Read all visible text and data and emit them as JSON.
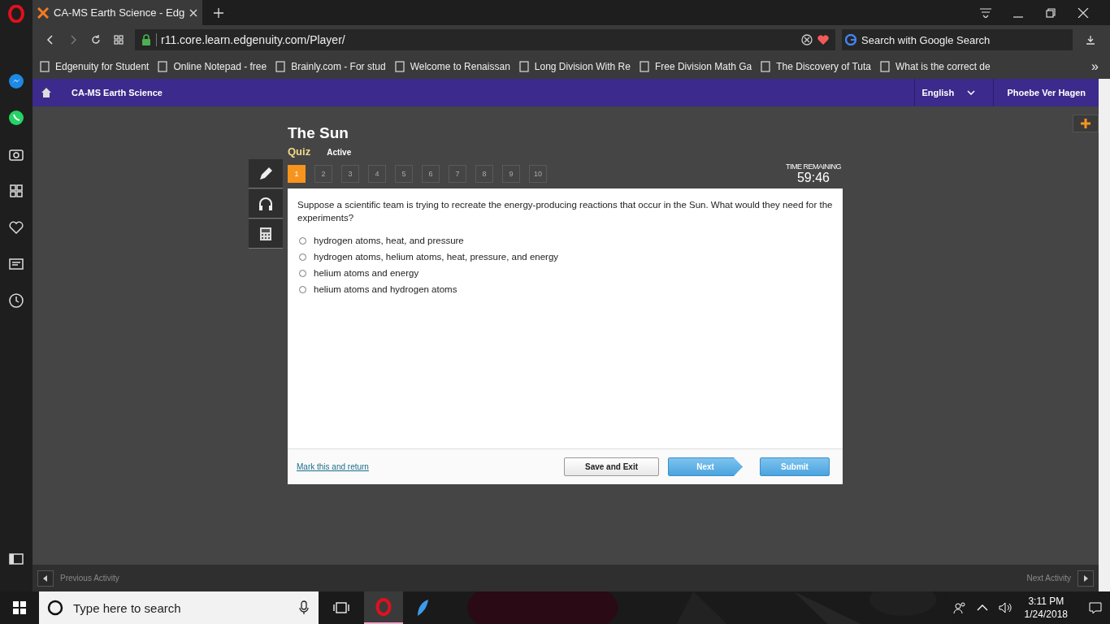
{
  "browser": {
    "tab": {
      "title": "CA-MS Earth Science - Edg"
    },
    "address": "r11.core.learn.edgenuity.com/Player/",
    "search": {
      "placeholder": "Search with Google Search"
    },
    "bookmarks": [
      "Edgenuity for Student",
      "Online Notepad - free",
      "Brainly.com - For stud",
      "Welcome to Renaissan",
      "Long Division With Re",
      "Free Division Math Ga",
      "The Discovery of Tuta",
      "What is the correct de"
    ],
    "more": "»"
  },
  "nav": {
    "course": "CA-MS Earth Science",
    "language": "English",
    "user": "Phoebe Ver Hagen"
  },
  "quiz": {
    "title": "The Sun",
    "type": "Quiz",
    "status": "Active",
    "questions": [
      {
        "label": "1",
        "selected": true
      },
      {
        "label": "2",
        "selected": false
      },
      {
        "label": "3",
        "selected": false
      },
      {
        "label": "4",
        "selected": false
      },
      {
        "label": "5",
        "selected": false
      },
      {
        "label": "6",
        "selected": false
      },
      {
        "label": "7",
        "selected": false
      },
      {
        "label": "8",
        "selected": false
      },
      {
        "label": "9",
        "selected": false
      },
      {
        "label": "10",
        "selected": false
      }
    ],
    "timer": {
      "label": "TIME REMAINING",
      "value": "59:46"
    },
    "question": "Suppose a scientific team is trying to recreate the energy-producing reactions that occur in the Sun. What would they need for the experiments?",
    "options": [
      {
        "text": "hydrogen atoms, heat, and pressure",
        "selected": false
      },
      {
        "text": "hydrogen atoms, helium atoms, heat, pressure, and energy",
        "selected": false
      },
      {
        "text": "helium atoms and energy",
        "selected": false
      },
      {
        "text": "helium atoms and hydrogen atoms",
        "selected": false
      }
    ],
    "mark_link": "Mark this and return",
    "buttons": [
      "Save and Exit",
      "Next",
      "Submit"
    ]
  },
  "footer": {
    "previous": "Previous Activity",
    "next": "Next Activity"
  },
  "taskbar": {
    "search": {
      "placeholder": "Type here to search"
    },
    "time": "3:11 PM",
    "date": "1/24/2018"
  }
}
